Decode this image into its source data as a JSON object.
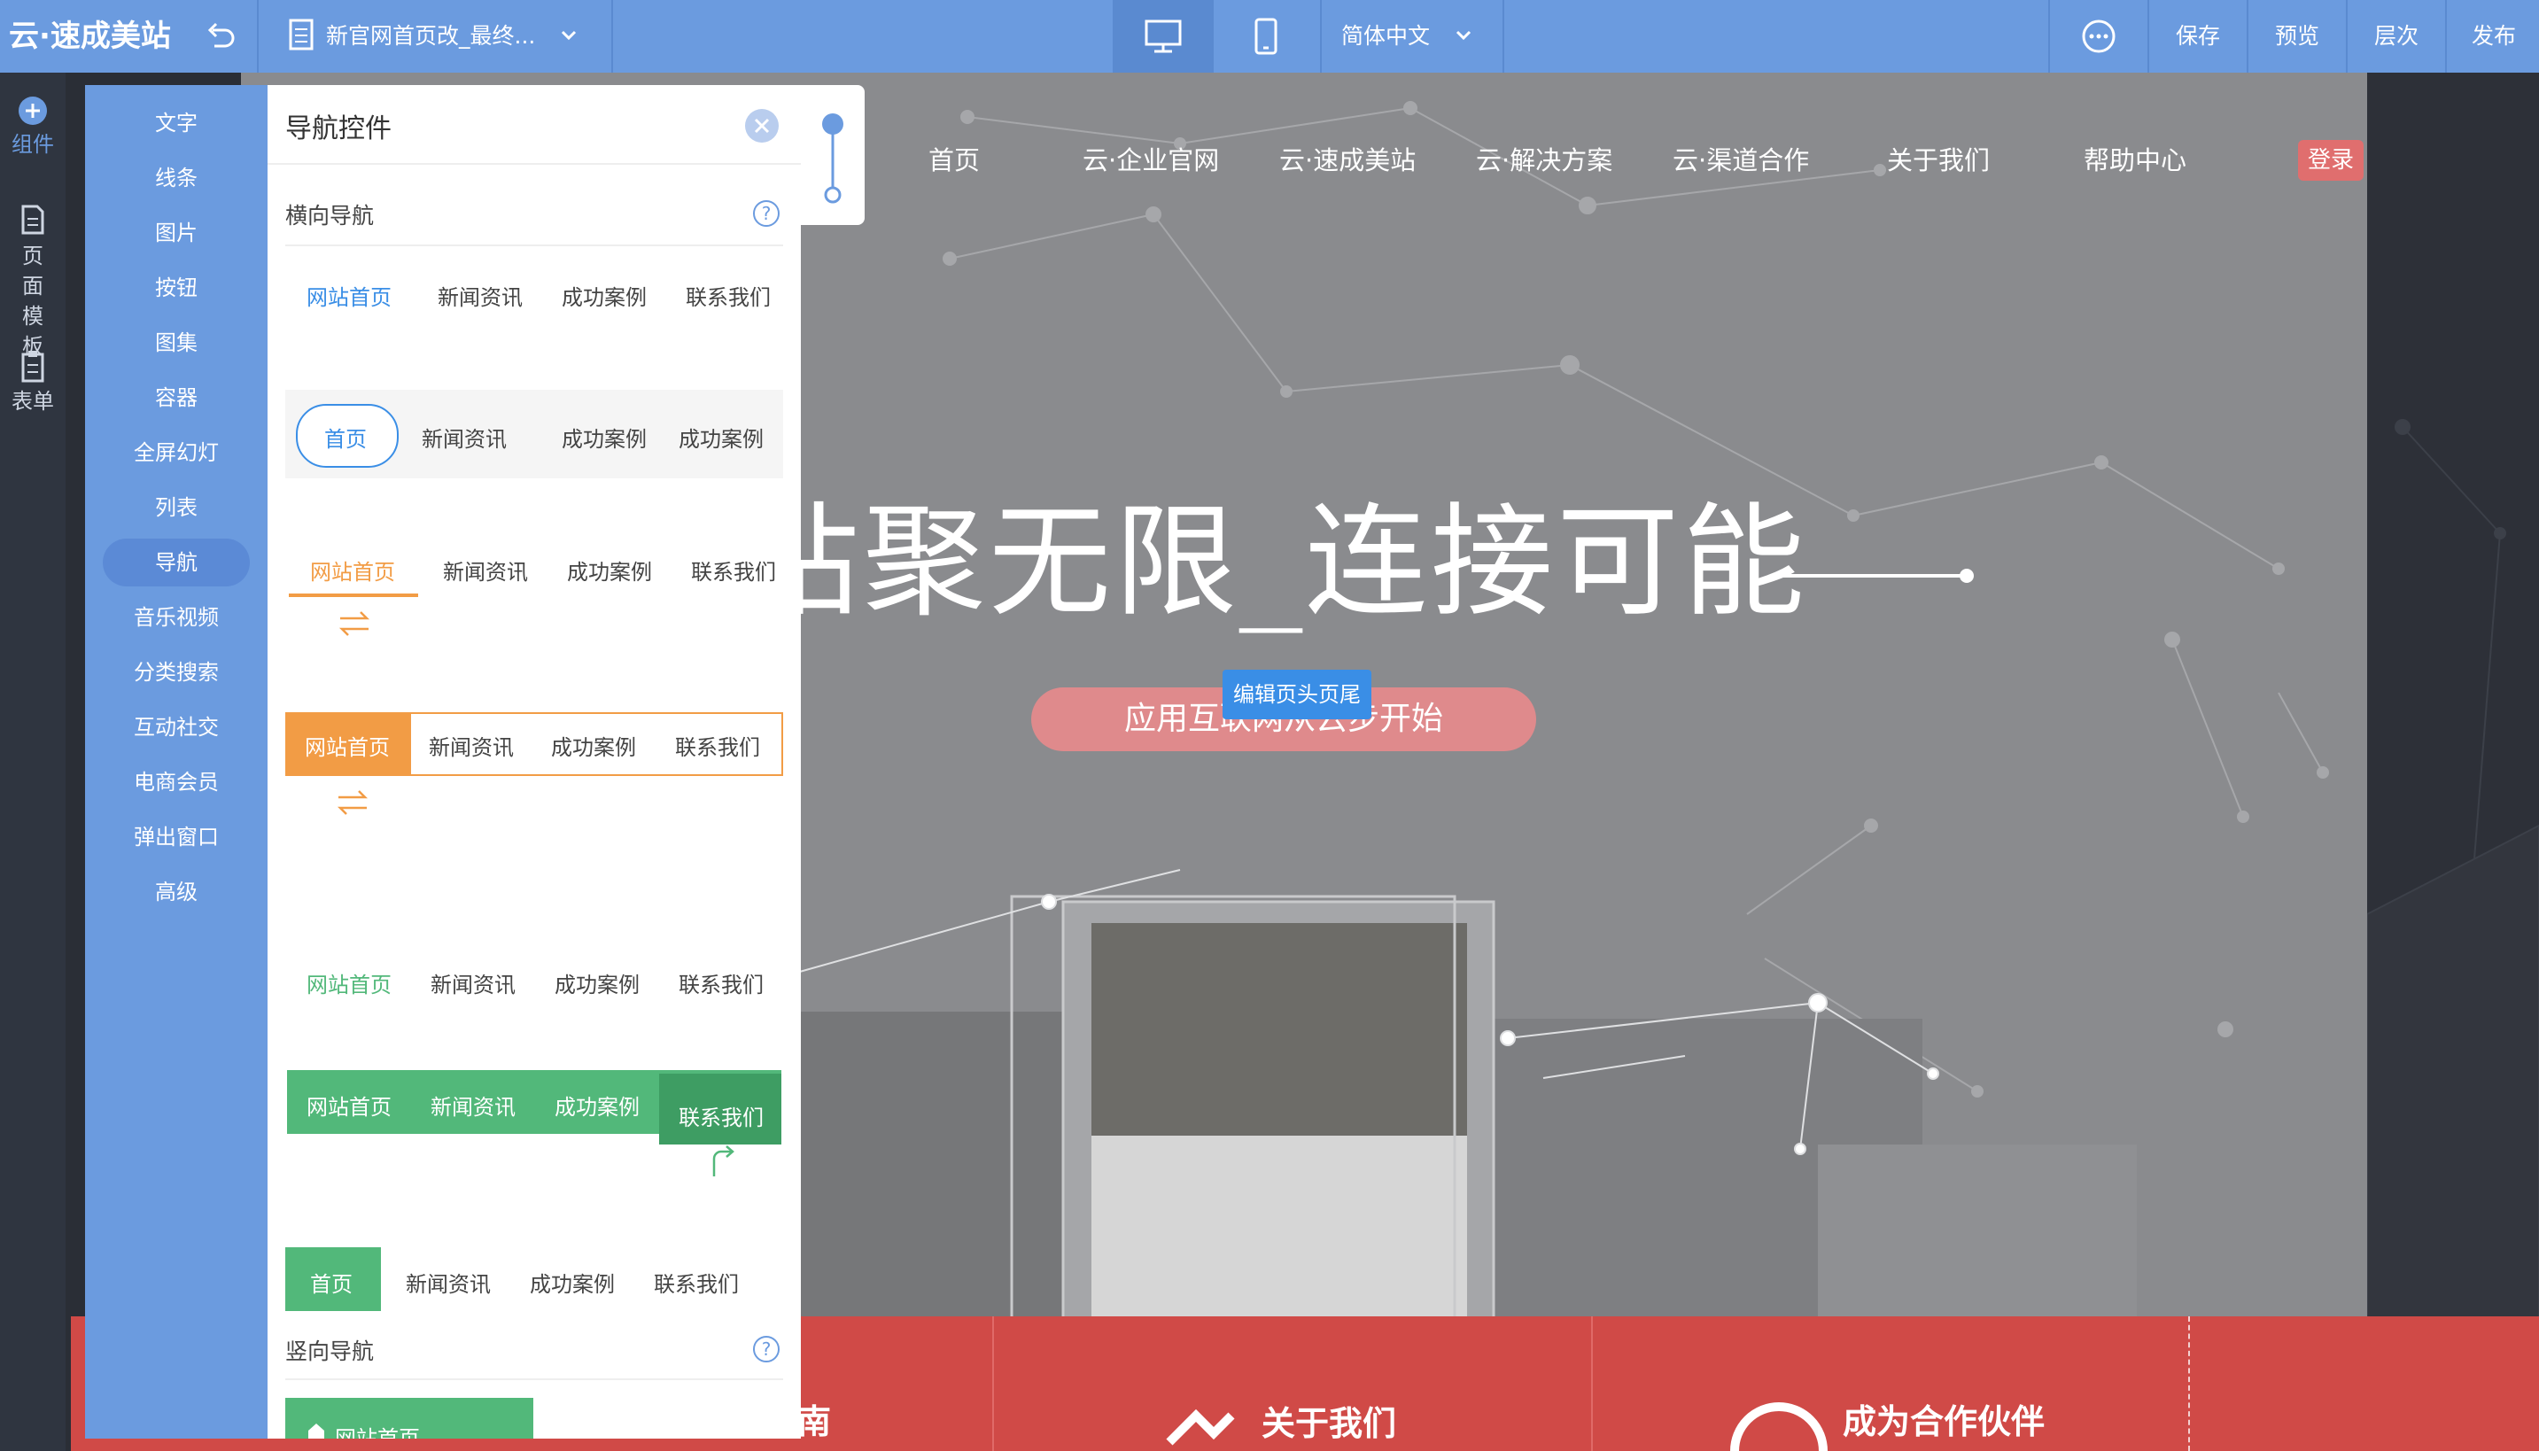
{
  "topbar": {
    "logo": "云·速成美站",
    "doc_title": "新官网首页改_最终...",
    "language": "简体中文",
    "actions": [
      "保存",
      "预览",
      "层次",
      "发布"
    ]
  },
  "rail": [
    {
      "label": "组件"
    },
    {
      "label": "页面模板"
    },
    {
      "label": "表单"
    }
  ],
  "categories": [
    "文字",
    "线条",
    "图片",
    "按钮",
    "图集",
    "容器",
    "全屏幻灯",
    "列表",
    "导航",
    "音乐视频",
    "分类搜索",
    "互动社交",
    "电商会员",
    "弹出窗口",
    "高级"
  ],
  "panel": {
    "title": "导航控件",
    "section_h": "横向导航",
    "section_v": "竖向导航",
    "help": "?",
    "presets": [
      [
        "网站首页",
        "新闻资讯",
        "成功案例",
        "联系我们"
      ],
      [
        "首页",
        "新闻资讯",
        "成功案例",
        "成功案例"
      ],
      [
        "网站首页",
        "新闻资讯",
        "成功案例",
        "联系我们"
      ],
      [
        "网站首页",
        "新闻资讯",
        "成功案例",
        "联系我们"
      ],
      [
        "网站首页",
        "新闻资讯",
        "成功案例",
        "联系我们"
      ],
      [
        "网站首页",
        "新闻资讯",
        "成功案例",
        "联系我们"
      ],
      [
        "首页",
        "新闻资讯",
        "成功案例",
        "联系我们"
      ]
    ],
    "vertical_first": "网站首页"
  },
  "canvas": {
    "nav": [
      "首页",
      "云·企业官网",
      "云·速成美站",
      "云·解决方案",
      "云·渠道合作",
      "关于我们",
      "帮助中心"
    ],
    "login": "登录",
    "headline": "站聚无限_连接可能",
    "cta": "应用互联网从云步开始",
    "edit_tag": "编辑页头页尾"
  },
  "bottom": {
    "items": [
      "南",
      "关于我们",
      "成为合作伙伴"
    ]
  },
  "colors": {
    "accent": "#6b9bdf",
    "orange": "#f29c45",
    "green": "#52b87a",
    "red": "#d04a47",
    "blue_link": "#3a8ee6"
  }
}
